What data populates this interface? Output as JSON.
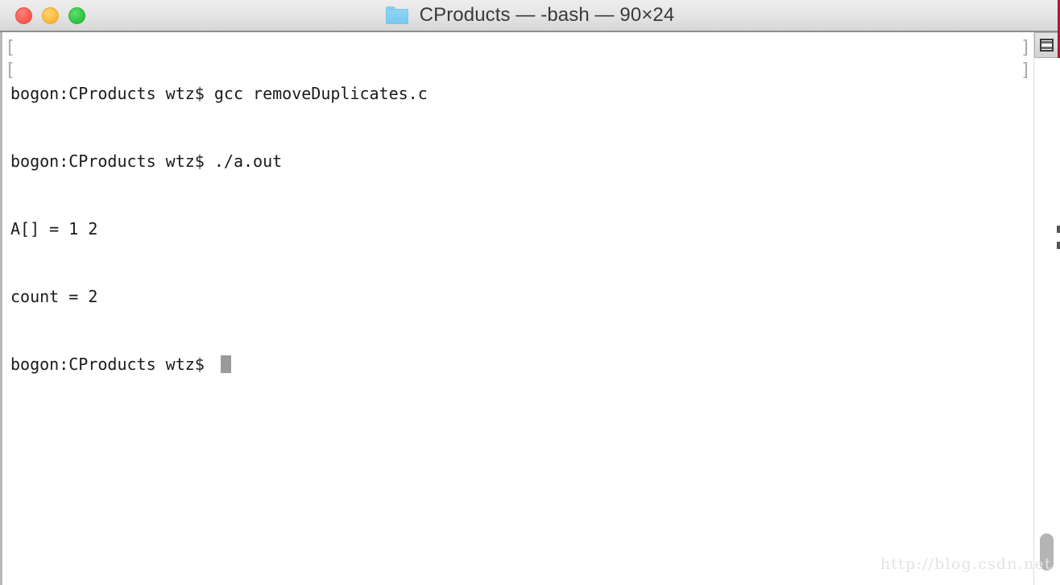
{
  "window": {
    "title": "CProducts — -bash — 90×24",
    "folder_icon": "folder-icon",
    "controls": {
      "close_label": "",
      "minimize_label": "",
      "zoom_label": "",
      "close_color": "#fb5c54",
      "minimize_color": "#fdbc40",
      "zoom_color": "#33c748"
    }
  },
  "terminal": {
    "background_color": "#ffffff",
    "foreground_color": "#1a1a1a",
    "cursor_color": "#9a9a9a",
    "prompt_mark": "[",
    "prompt_mark_end": "]",
    "lines": [
      {
        "text": "bogon:CProducts wtz$ gcc removeDuplicates.c",
        "mark": true
      },
      {
        "text": "bogon:CProducts wtz$ ./a.out",
        "mark": true
      },
      {
        "text": "A[] = 1 2",
        "mark": false
      },
      {
        "text": "count = 2",
        "mark": false
      },
      {
        "text": "bogon:CProducts wtz$ ",
        "mark": false,
        "cursor": true
      }
    ]
  },
  "toolbar": {
    "pane_button_name": "split-pane-icon"
  },
  "scrollbar": {
    "thumb_color": "#b4b4b4"
  },
  "watermark": {
    "text": "http://blog.csdn.net"
  }
}
